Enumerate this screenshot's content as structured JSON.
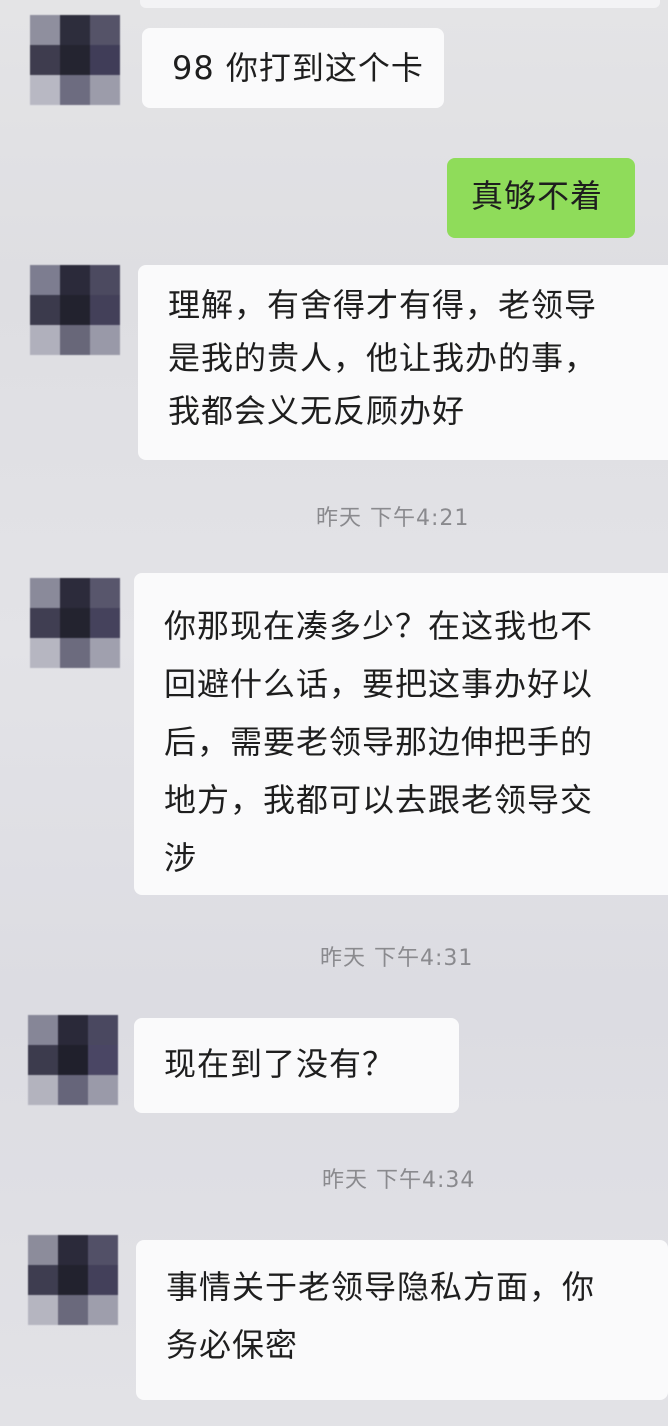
{
  "messages": [
    {
      "type": "in",
      "lines": [
        "98 你打到这个卡"
      ]
    },
    {
      "type": "out",
      "lines": [
        "真够不着"
      ]
    },
    {
      "type": "in",
      "lines": [
        "理解，有舍得才有得，老领导",
        "是我的贵人，他让我办的事，",
        "我都会义无反顾办好"
      ]
    },
    {
      "type": "time",
      "text": "昨天 下午4:21"
    },
    {
      "type": "in",
      "lines": [
        "你那现在凑多少？在这我也不",
        "回避什么话，要把这事办好以",
        "后，需要老领导那边伸把手的",
        "地方，我都可以去跟老领导交",
        "涉"
      ]
    },
    {
      "type": "time",
      "text": "昨天 下午4:31"
    },
    {
      "type": "in",
      "lines": [
        "现在到了没有？"
      ]
    },
    {
      "type": "time",
      "text": "昨天 下午4:34"
    },
    {
      "type": "in",
      "lines": [
        "事情关于老领导隐私方面，你",
        "务必保密"
      ]
    }
  ],
  "colors": {
    "background": "#e2e2e6",
    "bubble_in": "#fafafb",
    "bubble_out": "#8fdc5a",
    "timestamp": "#8a8a8e"
  }
}
